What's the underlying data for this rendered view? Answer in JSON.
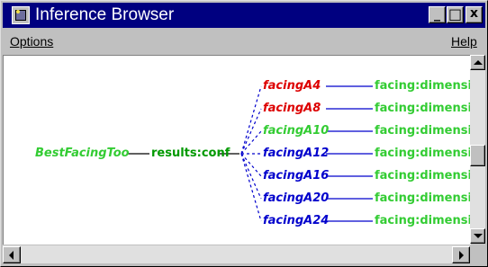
{
  "window": {
    "title": "Inference Browser",
    "controls": {
      "minimize": "_",
      "maximize": "□",
      "close": "x"
    }
  },
  "menu": {
    "options": "Options",
    "help": "Help"
  },
  "graph": {
    "root": {
      "label": "BestFacingToo",
      "color": "#33cc33"
    },
    "middle": {
      "label": "results:conf",
      "color": "#009900"
    },
    "children": [
      {
        "label": "facingA4",
        "color": "#dd0000",
        "target": "facing:dimensi"
      },
      {
        "label": "facingA8",
        "color": "#dd0000",
        "target": "facing:dimensi"
      },
      {
        "label": "facingA10",
        "color": "#33cc33",
        "target": "facing:dimensi"
      },
      {
        "label": "facingA12",
        "color": "#0000cc",
        "target": "facing:dimensi"
      },
      {
        "label": "facingA16",
        "color": "#0000cc",
        "target": "facing:dimensi"
      },
      {
        "label": "facingA20",
        "color": "#0000cc",
        "target": "facing:dimensi"
      },
      {
        "label": "facingA24",
        "color": "#0000cc",
        "target": "facing:dimensi"
      }
    ],
    "edge_color": "#0000cc",
    "target_color": "#33cc33"
  },
  "colors": {
    "titlebar": "#000080",
    "chrome": "#c0c0c0"
  }
}
